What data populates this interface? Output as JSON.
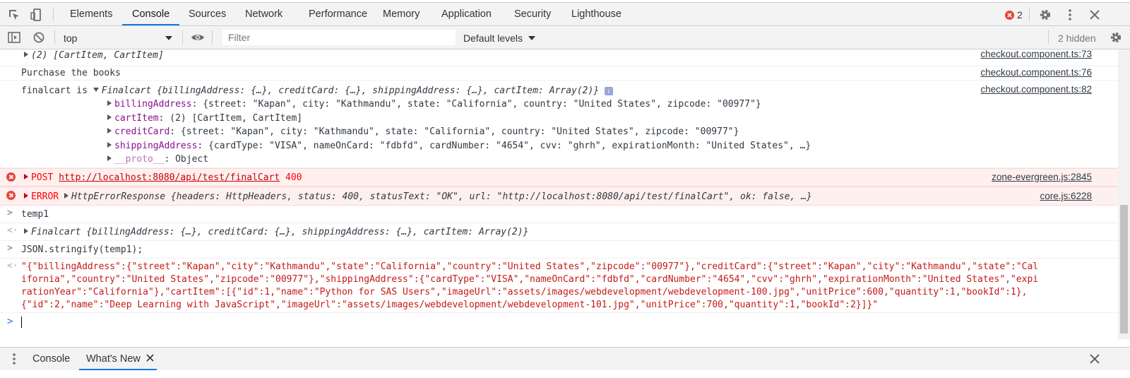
{
  "tabs": [
    {
      "label": "Elements"
    },
    {
      "label": "Console",
      "active": true
    },
    {
      "label": "Sources"
    },
    {
      "label": "Network"
    },
    {
      "label": "Performance"
    },
    {
      "label": "Memory"
    },
    {
      "label": "Application"
    },
    {
      "label": "Security"
    },
    {
      "label": "Lighthouse"
    }
  ],
  "error_count": "2",
  "toolbar": {
    "context": "top",
    "filter_placeholder": "Filter",
    "levels": "Default levels",
    "hidden": "2 hidden"
  },
  "console": {
    "row1": {
      "text": "(2) [CartItem, CartItem]",
      "source": "checkout.component.ts:73"
    },
    "row2": {
      "text": "Purchase the books",
      "source": "checkout.component.ts:76"
    },
    "row3": {
      "prefix": "finalcart is ",
      "summary": "Finalcart {billingAddress: {…}, creditCard: {…}, shippingAddress: {…}, cartItem: Array(2)}",
      "source": "checkout.component.ts:82",
      "billing_key": "billingAddress",
      "billing_val": ": {street: \"Kapan\", city: \"Kathmandu\", state: \"California\", country: \"United States\", zipcode: \"00977\"}",
      "cart_key": "cartItem",
      "cart_val": ": (2) [CartItem, CartItem]",
      "credit_key": "creditCard",
      "credit_val": ": {street: \"Kapan\", city: \"Kathmandu\", state: \"California\", country: \"United States\", zipcode: \"00977\"}",
      "shipping_key": "shippingAddress",
      "shipping_val": ": {cardType: \"VISA\", nameOnCard: \"fdbfd\", cardNumber: \"4654\", cvv: \"ghrh\", expirationMonth: \"United States\", …}",
      "proto_key": "__proto__",
      "proto_val": ": Object"
    },
    "row4": {
      "method": "POST",
      "url": "http://localhost:8080/api/test/finalCart",
      "status": "400",
      "source": "zone-evergreen.js:2845"
    },
    "row5": {
      "prefix": "ERROR ",
      "summary": "HttpErrorResponse {headers: HttpHeaders, status: 400, statusText: \"OK\", url: \"http://localhost:8080/api/test/finalCart\", ok: false, …}",
      "source": "core.js:6228"
    },
    "row6": {
      "text": "temp1"
    },
    "row7": {
      "text": "Finalcart {billingAddress: {…}, creditCard: {…}, shippingAddress: {…}, cartItem: Array(2)}"
    },
    "row8": {
      "text": "JSON.stringify(temp1);"
    },
    "row9": {
      "l1": "\"{\"billingAddress\":{\"street\":\"Kapan\",\"city\":\"Kathmandu\",\"state\":\"California\",\"country\":\"United States\",\"zipcode\":\"00977\"},\"creditCard\":{\"street\":\"Kapan\",\"city\":\"Kathmandu\",\"state\":\"Cal",
      "l2": "ifornia\",\"country\":\"United States\",\"zipcode\":\"00977\"},\"shippingAddress\":{\"cardType\":\"VISA\",\"nameOnCard\":\"fdbfd\",\"cardNumber\":\"4654\",\"cvv\":\"ghrh\",\"expirationMonth\":\"United States\",\"expi",
      "l3": "rationYear\":\"California\"},\"cartItem\":[{\"id\":1,\"name\":\"Python for SAS Users\",\"imageUrl\":\"assets/images/webdevelopment/webdevelopment-100.jpg\",\"unitPrice\":600,\"quantity\":1,\"bookId\":1},",
      "l4": "{\"id\":2,\"name\":\"Deep Learning with JavaScript\",\"imageUrl\":\"assets/images/webdevelopment/webdevelopment-101.jpg\",\"unitPrice\":700,\"quantity\":1,\"bookId\":2}]}\""
    }
  },
  "drawer": {
    "tabs": [
      {
        "label": "Console"
      },
      {
        "label": "What's New"
      }
    ]
  }
}
